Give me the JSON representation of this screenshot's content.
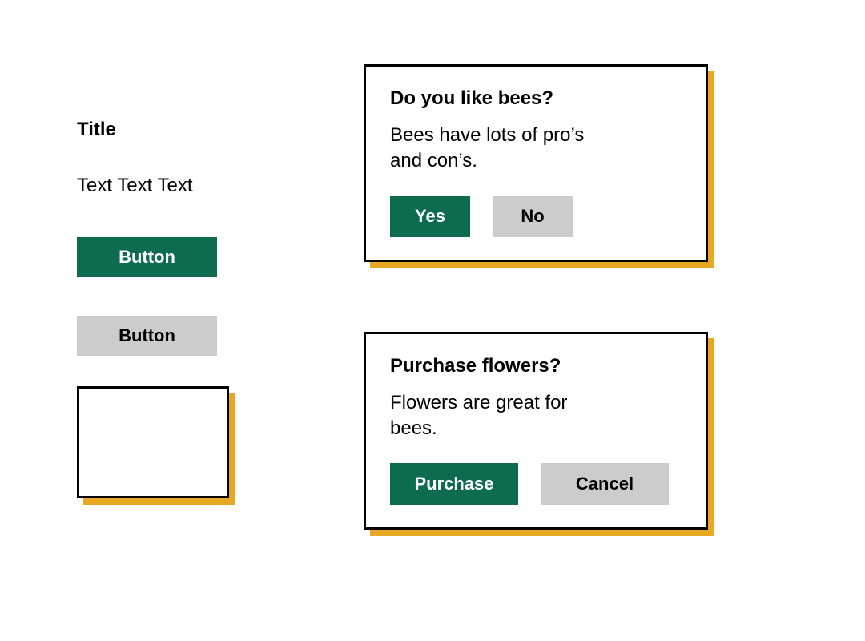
{
  "colors": {
    "primary": "#0d6b4e",
    "secondary": "#cccccc",
    "shadow": "#e8a823",
    "border": "#000000",
    "background": "#ffffff"
  },
  "left": {
    "title": "Title",
    "body": "Text Text Text",
    "primary_button_label": "Button",
    "secondary_button_label": "Button"
  },
  "dialogs": [
    {
      "title": "Do you like bees?",
      "body": "Bees have lots of pro’s and con’s.",
      "primary_label": "Yes",
      "secondary_label": "No"
    },
    {
      "title": "Purchase flowers?",
      "body": "Flowers are great for bees.",
      "primary_label": "Purchase",
      "secondary_label": "Cancel"
    }
  ]
}
